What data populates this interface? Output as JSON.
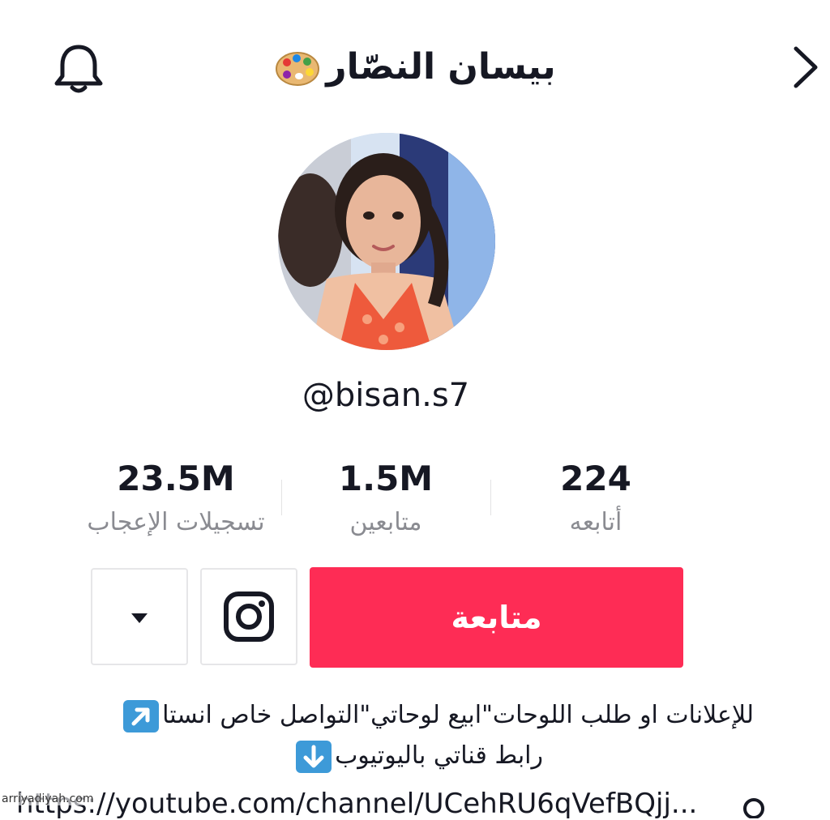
{
  "header": {
    "title": "بيسان النصّار"
  },
  "profile": {
    "handle": "@bisan.s7"
  },
  "stats": [
    {
      "value": "224",
      "label": "أتابعه"
    },
    {
      "value": "1.5M",
      "label": "متابعين"
    },
    {
      "value": "23.5M",
      "label": "تسجيلات الإعجاب"
    }
  ],
  "actions": {
    "follow_label": "متابعة"
  },
  "bio": {
    "line1": "للإعلانات او طلب اللوحات\"ابيع لوحاتي\"التواصل خاص انستا",
    "line2": "رابط قناتي باليوتيوب"
  },
  "link": {
    "url": "https://youtube.com/channel/UCehRU6qVefBQjj..."
  },
  "watermark": "arriyadiyah.com",
  "colors": {
    "follow_button": "#fe2c55",
    "secondary_text": "#8a8b91",
    "emoji_blue": "#3d9ad8"
  },
  "icons": {
    "left": "bell-icon",
    "right": "chevron-right-icon",
    "title_emoji": "artist-palette-icon",
    "social": "instagram-icon",
    "more": "caret-down-icon",
    "bio_emoji1": "up-right-arrow-icon",
    "bio_emoji2": "down-arrow-icon",
    "link": "link-icon"
  }
}
